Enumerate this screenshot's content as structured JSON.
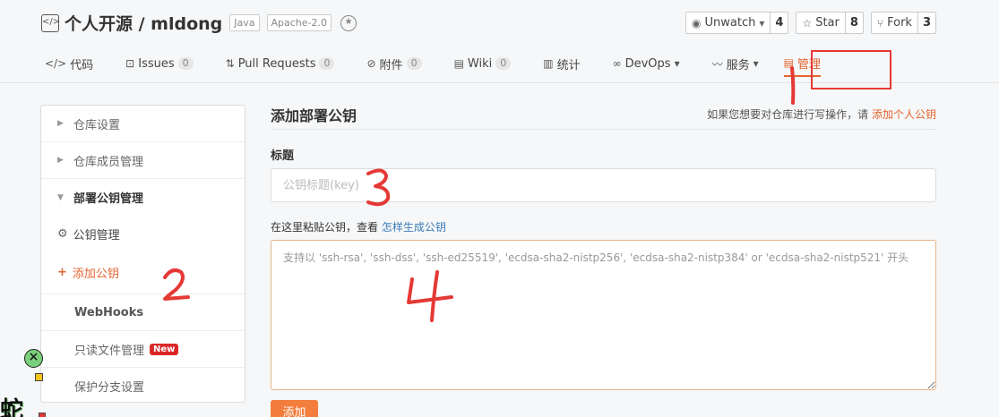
{
  "repo": {
    "title": "个人开源 / mldong",
    "tags": [
      "Java",
      "Apache-2.0"
    ],
    "watch_label": "Unwatch",
    "watch_count": "4",
    "star_label": "Star",
    "star_count": "8",
    "fork_label": "Fork",
    "fork_count": "3"
  },
  "tabs": [
    {
      "label": "代码",
      "icon": "code-icon"
    },
    {
      "label": "Issues",
      "count": "0",
      "icon": "issues-icon"
    },
    {
      "label": "Pull Requests",
      "count": "0",
      "icon": "pull-request-icon"
    },
    {
      "label": "附件",
      "count": "0",
      "icon": "attachment-icon"
    },
    {
      "label": "Wiki",
      "count": "0",
      "icon": "wiki-icon"
    },
    {
      "label": "统计",
      "icon": "stats-icon"
    },
    {
      "label": "DevOps",
      "icon": "devops-icon"
    },
    {
      "label": "服务",
      "icon": "service-icon"
    },
    {
      "label": "管理",
      "icon": "manage-icon"
    }
  ],
  "sidebar": {
    "repo_settings": "仓库设置",
    "members": "仓库成员管理",
    "deploy_keys": "部署公钥管理",
    "key_manage": "公钥管理",
    "add_key": "添加公钥",
    "webhooks": "WebHooks",
    "readonly_files": "只读文件管理",
    "new_badge": "New",
    "branch_protect": "保护分支设置"
  },
  "main": {
    "title": "添加部署公钥",
    "hint_text": "如果您想要对仓库进行写操作，请",
    "hint_link": "添加个人公钥",
    "title_label": "标题",
    "title_placeholder": "公钥标题(key)",
    "paste_text": "在这里粘贴公钥，查看",
    "paste_link": "怎样生成公钥",
    "key_placeholder": "支持以 'ssh-rsa', 'ssh-dss', 'ssh-ed25519', 'ecdsa-sha2-nistp256', 'ecdsa-sha2-nistp384' or 'ecdsa-sha2-nistp521' 开头",
    "submit": "添加"
  },
  "annotations": {
    "n1": "1",
    "n2": "2",
    "n3": "3",
    "n4": "4"
  },
  "floating": {
    "char": "蛇"
  },
  "colors": {
    "accent": "#e4632e",
    "annotation": "#e53935",
    "button": "#f27d3c",
    "link": "#3a7ab8"
  }
}
